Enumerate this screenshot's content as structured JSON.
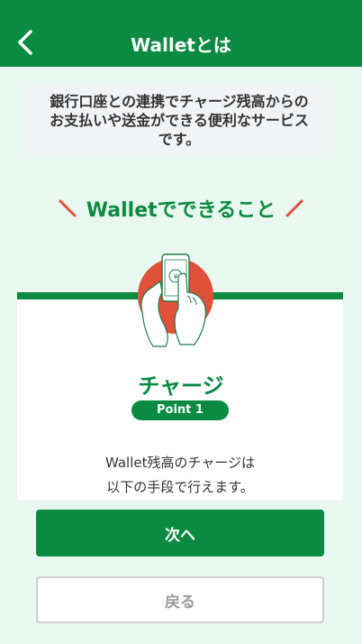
{
  "header": {
    "title": "Walletとは",
    "back_icon": "chevron-left-icon"
  },
  "intro": {
    "text": "銀行口座との連携でチャージ残高からの\nお支払いや送金ができる便利なサービス\nです。"
  },
  "section": {
    "heading": "Walletでできること"
  },
  "feature": {
    "title": "チャージ",
    "badge": "Point 1",
    "description": "Wallet残高のチャージは\n以下の手段で行えます。",
    "illustration_icon": "hand-holding-phone-icon",
    "yen_symbol": "¥"
  },
  "buttons": {
    "next": "次へ",
    "back": "戻る"
  },
  "colors": {
    "brand_green": "#0b8a42",
    "background": "#e8f7ef",
    "accent_red": "#e0503a"
  }
}
